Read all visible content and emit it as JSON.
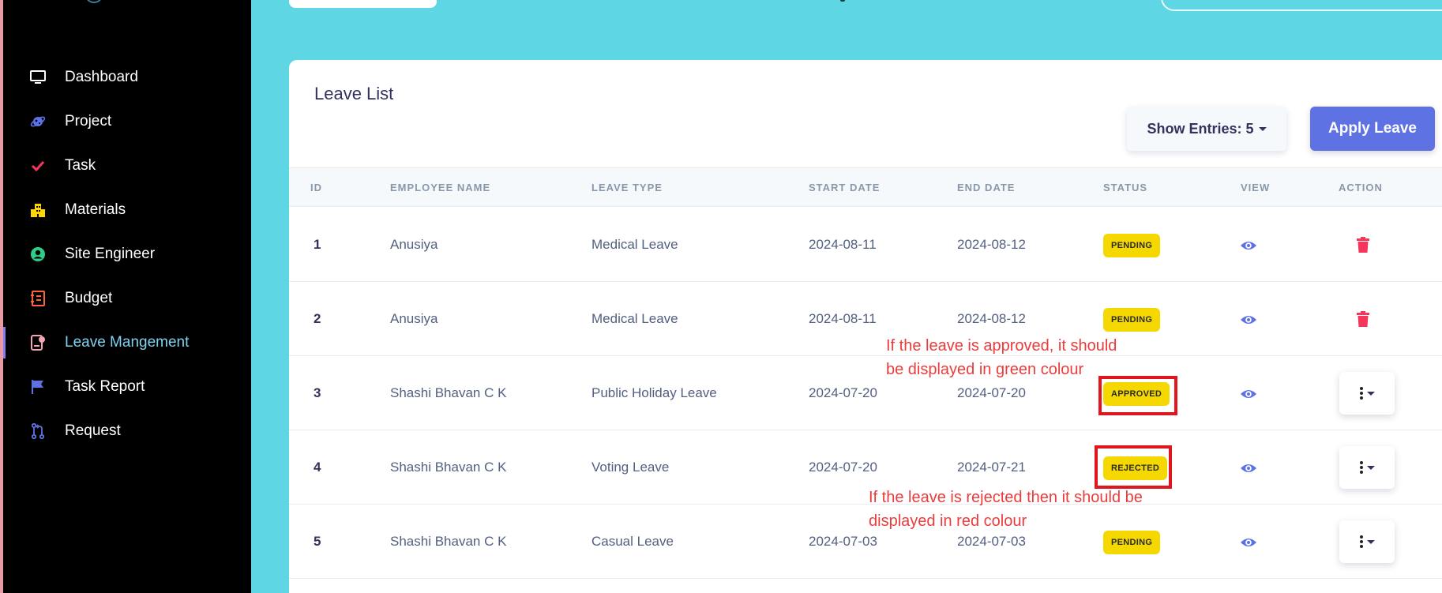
{
  "sidebar": {
    "items": [
      {
        "label": "Dashboard",
        "icon": "monitor-icon",
        "color": "#ffffff",
        "active": false
      },
      {
        "label": "Project",
        "icon": "planet-icon",
        "color": "#5e72e4",
        "active": false
      },
      {
        "label": "Task",
        "icon": "check-icon",
        "color": "#f5365c",
        "active": false
      },
      {
        "label": "Materials",
        "icon": "building-icon",
        "color": "#ffd600",
        "active": false
      },
      {
        "label": "Site Engineer",
        "icon": "user-circle-icon",
        "color": "#2dce89",
        "active": false
      },
      {
        "label": "Budget",
        "icon": "budget-icon",
        "color": "#fb6340",
        "active": false
      },
      {
        "label": "Leave Mangement",
        "icon": "leave-icon",
        "color": "#f3a4b5",
        "active": true
      },
      {
        "label": "Task Report",
        "icon": "flag-icon",
        "color": "#5e72e4",
        "active": false
      },
      {
        "label": "Request",
        "icon": "pull-request-icon",
        "color": "#5e72e4",
        "active": false
      }
    ]
  },
  "card": {
    "title": "Leave List",
    "show_entries_label": "Show Entries: 5",
    "apply_leave_label": "Apply Leave"
  },
  "table": {
    "headers": [
      "ID",
      "EMPLOYEE NAME",
      "LEAVE TYPE",
      "START DATE",
      "END DATE",
      "STATUS",
      "VIEW",
      "ACTION"
    ],
    "rows": [
      {
        "id": "1",
        "name": "Anusiya",
        "type": "Medical Leave",
        "start": "2024-08-11",
        "end": "2024-08-12",
        "status": "PENDING",
        "action": "delete"
      },
      {
        "id": "2",
        "name": "Anusiya",
        "type": "Medical Leave",
        "start": "2024-08-11",
        "end": "2024-08-12",
        "status": "PENDING",
        "action": "delete"
      },
      {
        "id": "3",
        "name": "Shashi Bhavan C K",
        "type": "Public Holiday Leave",
        "start": "2024-07-20",
        "end": "2024-07-20",
        "status": "APPROVED",
        "action": "menu"
      },
      {
        "id": "4",
        "name": "Shashi Bhavan C K",
        "type": "Voting Leave",
        "start": "2024-07-20",
        "end": "2024-07-21",
        "status": "REJECTED",
        "action": "menu"
      },
      {
        "id": "5",
        "name": "Shashi Bhavan C K",
        "type": "Casual Leave",
        "start": "2024-07-03",
        "end": "2024-07-03",
        "status": "PENDING",
        "action": "menu"
      }
    ]
  },
  "annotations": {
    "approved_note_line1": "If the leave is approved, it should",
    "approved_note_line2": "be displayed in green colour",
    "rejected_note_line1": "If the leave is rejected then it should be",
    "rejected_note_line2": "displayed in red colour"
  },
  "colors": {
    "accent": "#5e72e4",
    "badge_yellow": "#f5d800",
    "annotation_red": "#e0151d",
    "background_cyan": "#5fd6e3"
  }
}
